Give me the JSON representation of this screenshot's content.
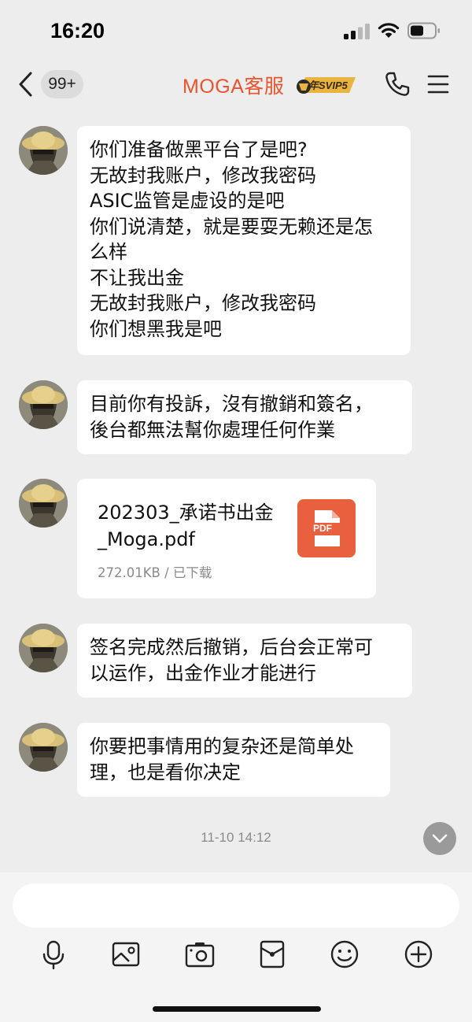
{
  "status_bar": {
    "time": "16:20"
  },
  "nav": {
    "unread_count": "99+",
    "title": "MOGA客服",
    "vip_badge": "年SVIP5",
    "accent_color": "#e8542d"
  },
  "messages": [
    {
      "type": "text",
      "lines": [
        "你们准备做黑平台了是吧?",
        "无故封我账户，修改我密码",
        "ASIC监管是虚设的是吧",
        "你们说清楚，就是要耍无赖还是怎",
        "么样",
        "不让我出金",
        "无故封我账户，修改我密码",
        "你们想黑我是吧"
      ]
    },
    {
      "type": "text",
      "lines": [
        "目前你有投訴，沒有撤銷和簽名，",
        "後台都無法幫你處理任何作業"
      ]
    },
    {
      "type": "file",
      "name_lines": [
        "202303_承诺书出金",
        "_Moga.pdf"
      ],
      "meta": "272.01KB / 已下载",
      "icon_label": "PDF"
    },
    {
      "type": "text",
      "lines": [
        "签名完成然后撤销，后台会正常可",
        "以运作，出金作业才能进行"
      ]
    },
    {
      "type": "text",
      "lines": [
        "你要把事情用的复杂还是简单处",
        "理，也是看你决定"
      ]
    }
  ],
  "timestamp": "11-10 14:12",
  "input": {
    "placeholder": ""
  },
  "toolbar": {
    "icons": [
      "microphone-icon",
      "image-icon",
      "camera-icon",
      "red-packet-icon",
      "emoji-icon",
      "plus-icon"
    ]
  }
}
